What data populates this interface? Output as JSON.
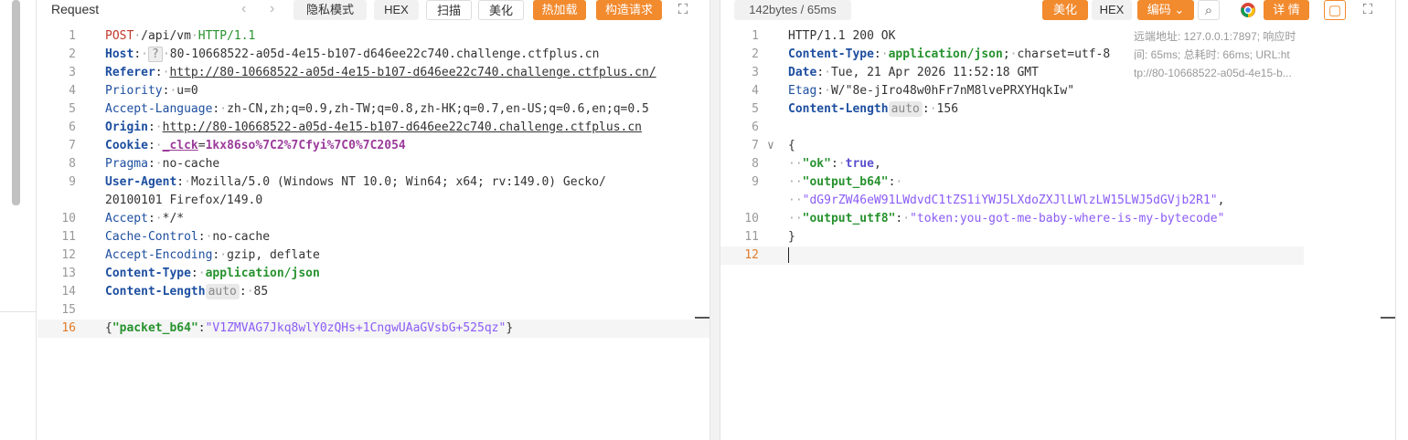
{
  "request": {
    "title": "Request",
    "buttons": {
      "private": "隐私模式",
      "hex": "HEX",
      "scan": "扫描",
      "beautify": "美化",
      "hotload": "热加载",
      "construct": "构造请求"
    },
    "line_numbers": [
      "1",
      "2",
      "3",
      "4",
      "5",
      "6",
      "7",
      "8",
      "9",
      "",
      "10",
      "11",
      "12",
      "13",
      "14",
      "15",
      "16"
    ],
    "lines": {
      "method": "POST",
      "path": "/api/vm",
      "proto": "HTTP/1.1",
      "host_key": "Host",
      "host_q": "?",
      "host_val": "80-10668522-a05d-4e15-b107-d646ee22c740.challenge.ctfplus.cn",
      "referer_key": "Referer",
      "referer_val": "http://80-10668522-a05d-4e15-b107-d646ee22c740.challenge.ctfplus.cn/",
      "priority_key": "Priority",
      "priority_val": "u=0",
      "accept_lang_key": "Accept-Language",
      "accept_lang_val": "zh-CN,zh;q=0.9,zh-TW;q=0.8,zh-HK;q=0.7,en-US;q=0.6,en;q=0.5",
      "origin_key": "Origin",
      "origin_val": "http://80-10668522-a05d-4e15-b107-d646ee22c740.challenge.ctfplus.cn",
      "cookie_key": "Cookie",
      "cookie_name": "_clck",
      "cookie_val": "1kx86so%7C2%7Cfyi%7C0%7C2054",
      "pragma_key": "Pragma",
      "pragma_val": "no-cache",
      "ua_key": "User-Agent",
      "ua_val1": "Mozilla/5.0 (Windows NT 10.0; Win64; x64; rv:149.0) Gecko/",
      "ua_val2": "20100101 Firefox/149.0",
      "accept_key": "Accept",
      "accept_val": "*/*",
      "cache_key": "Cache-Control",
      "cache_val": "no-cache",
      "enc_key": "Accept-Encoding",
      "enc_val": "gzip, deflate",
      "ctype_key": "Content-Type",
      "ctype_val": "application/json",
      "clen_key": "Content-Length",
      "clen_auto": "auto",
      "clen_val": "85",
      "body_key": "packet_b64",
      "body_val": "V1ZMVAG7Jkq8wlY0zQHs+1CngwUAaGVsbG+525qz"
    }
  },
  "response": {
    "stats": "142bytes / 65ms",
    "buttons": {
      "beautify": "美化",
      "hex": "HEX",
      "encoding": "编码",
      "detail": "详 情"
    },
    "info": {
      "line1": "远端地址: 127.0.0.1:7897; 响应时",
      "line2": "间: 65ms; 总耗时: 66ms; URL:ht",
      "line3": "tp://80-10668522-a05d-4e15-b..."
    },
    "line_numbers": [
      "1",
      "2",
      "3",
      "4",
      "5",
      "6",
      "7",
      "8",
      "9",
      "",
      "10",
      "11",
      "12"
    ],
    "lines": {
      "status": "HTTP/1.1 200 OK",
      "ctype_key": "Content-Type",
      "ctype_val": "application/json",
      "ctype_rest": "charset=utf-8",
      "date_key": "Date",
      "date_val": "Tue, 21 Apr 2026 11:52:18 GMT",
      "etag_key": "Etag",
      "etag_val": "W/\"8e-jIro48w0hFr7nM8lvePRXYHqkIw\"",
      "clen_key": "Content-Length",
      "clen_auto": "auto",
      "clen_val": "156",
      "ok_key": "\"ok\"",
      "ok_val": "true",
      "b64_key": "\"output_b64\"",
      "b64_val": "\"dG9rZW46eW91LWdvdC1tZS1iYWJ5LXdoZXJlLWlzLW15LWJ5dGVjb2R1\"",
      "utf8_key": "\"output_utf8\"",
      "utf8_val": "\"token:you-got-me-baby-where-is-my-bytecode\""
    }
  }
}
